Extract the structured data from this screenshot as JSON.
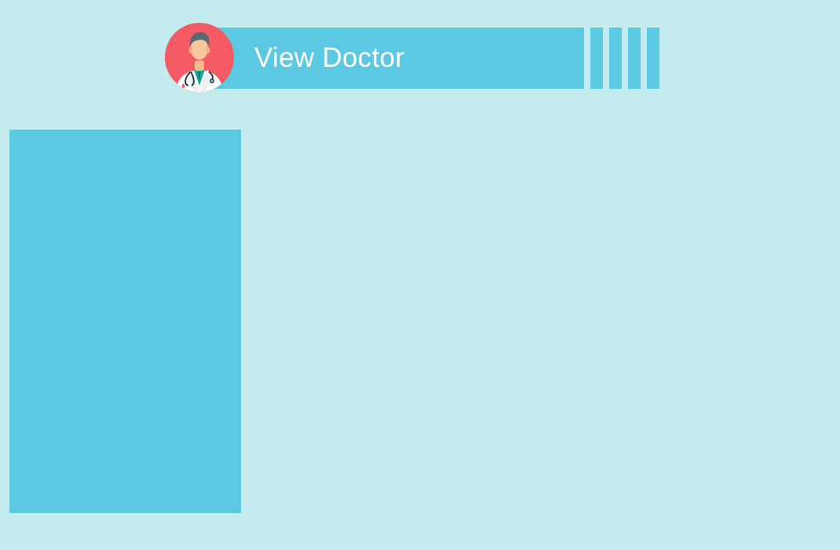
{
  "header": {
    "title": "View Doctor",
    "avatar_icon": "doctor-avatar-icon",
    "stripe_count": 4
  },
  "colors": {
    "background": "#c4ebee",
    "accent": "#5bc9e1",
    "avatar_background": "#f55b64",
    "title_text": "#ffffff"
  }
}
